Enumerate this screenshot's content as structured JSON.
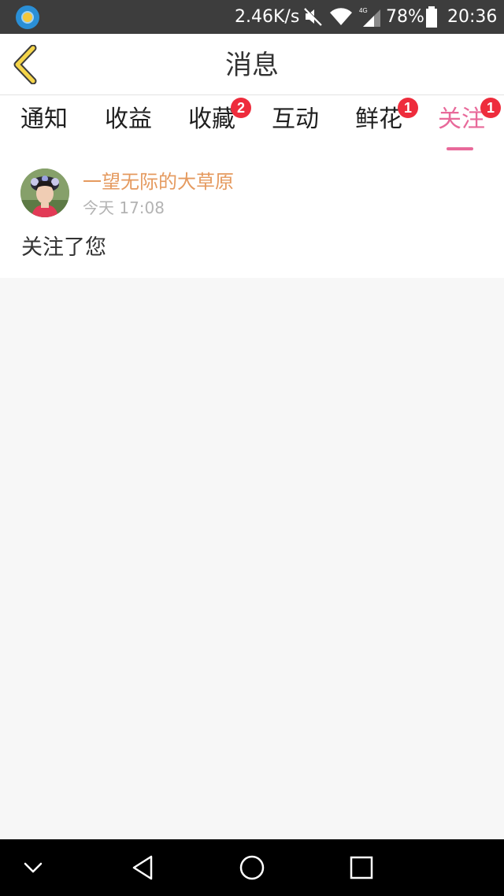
{
  "status_bar": {
    "speed": "2.46K/s",
    "network_type": "4G",
    "battery": "78%",
    "time": "20:36",
    "icons": [
      "weather-app-icon",
      "mute-icon",
      "wifi-icon",
      "signal-icon",
      "battery-icon"
    ]
  },
  "header": {
    "title": "消息",
    "back_icon": "chevron-left-icon",
    "accent_color": "#f5d54a"
  },
  "tabs": [
    {
      "label": "通知",
      "badge": null,
      "active": false
    },
    {
      "label": "收益",
      "badge": null,
      "active": false
    },
    {
      "label": "收藏",
      "badge": "2",
      "active": false
    },
    {
      "label": "互动",
      "badge": null,
      "active": false
    },
    {
      "label": "鲜花",
      "badge": "1",
      "active": false
    },
    {
      "label": "关注",
      "badge": "1",
      "active": true
    }
  ],
  "messages": [
    {
      "username": "一望无际的大草原",
      "time": "今天 17:08",
      "body": "关注了您"
    }
  ],
  "colors": {
    "active_tab": "#e8699a",
    "badge": "#ee2c3c",
    "username": "#e59a5f"
  },
  "nav_bar": {
    "icons": [
      "hide-keyboard-icon",
      "back-triangle-icon",
      "home-circle-icon",
      "recent-apps-icon"
    ]
  }
}
